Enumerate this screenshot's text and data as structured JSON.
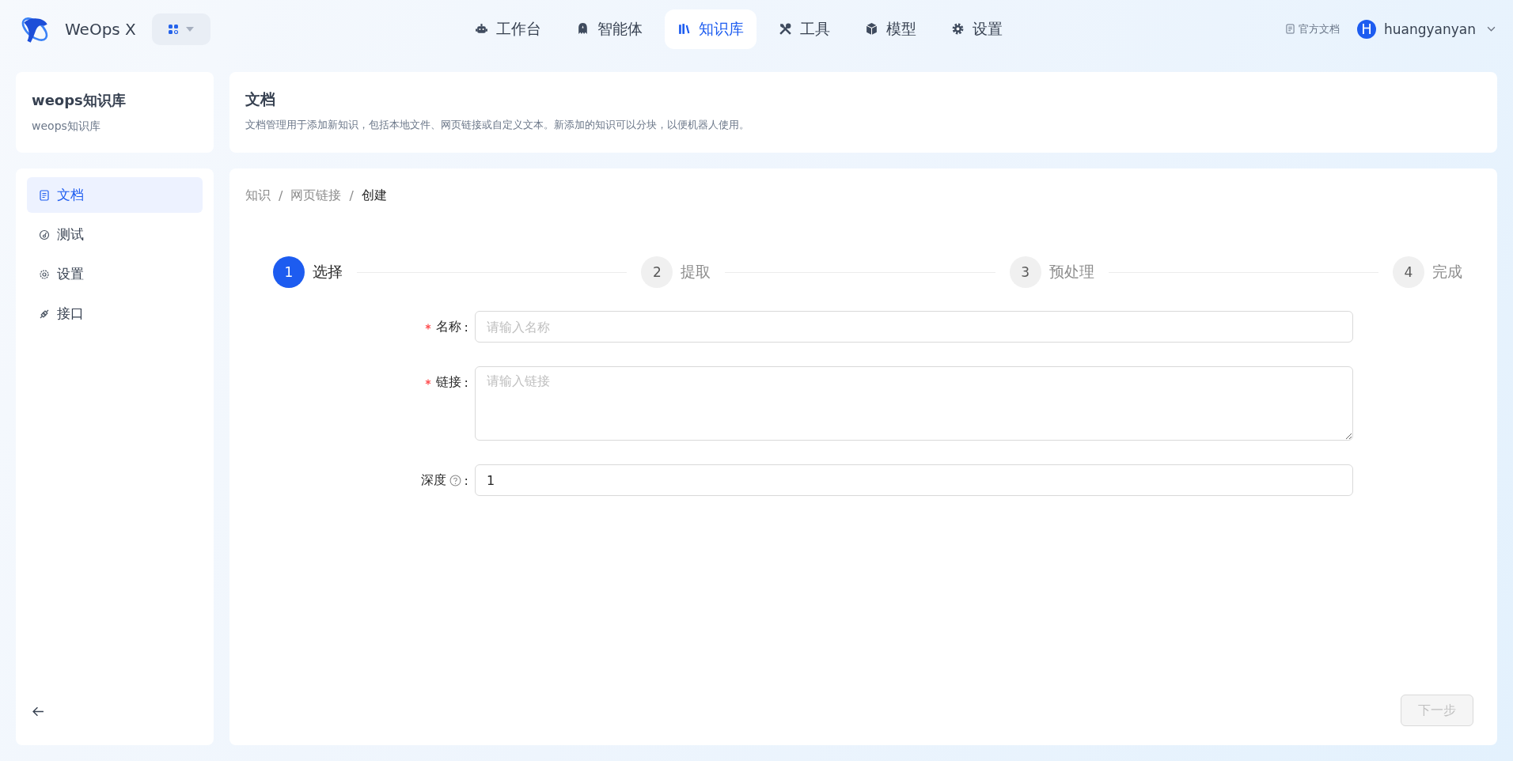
{
  "app": {
    "name": "WeOps X"
  },
  "nav": [
    {
      "label": "工作台",
      "selected": false
    },
    {
      "label": "智能体",
      "selected": false
    },
    {
      "label": "知识库",
      "selected": true
    },
    {
      "label": "工具",
      "selected": false
    },
    {
      "label": "模型",
      "selected": false
    },
    {
      "label": "设置",
      "selected": false
    }
  ],
  "docs_link": "官方文档",
  "user": {
    "initial": "H",
    "name": "huangyanyan"
  },
  "knowledge_base": {
    "title": "weops知识库",
    "subtitle": "weops知识库"
  },
  "sidebar": {
    "items": [
      {
        "label": "文档",
        "selected": true
      },
      {
        "label": "测试",
        "selected": false
      },
      {
        "label": "设置",
        "selected": false
      },
      {
        "label": "接口",
        "selected": false
      }
    ]
  },
  "header": {
    "title": "文档",
    "description": "文档管理用于添加新知识，包括本地文件、网页链接或自定义文本。新添加的知识可以分块，以便机器人使用。"
  },
  "breadcrumb": [
    {
      "label": "知识",
      "current": false
    },
    {
      "separator": "/",
      "label": "网页链接",
      "current": false
    },
    {
      "separator": "/",
      "label": "创建",
      "current": true
    }
  ],
  "steps": [
    {
      "number": "1",
      "label": "选择",
      "selected": true
    },
    {
      "number": "2",
      "label": "提取",
      "selected": false
    },
    {
      "number": "3",
      "label": "预处理",
      "selected": false
    },
    {
      "number": "4",
      "label": "完成",
      "selected": false
    }
  ],
  "form": [
    {
      "kind": "input",
      "label": "名称",
      "colon": ":",
      "required": true,
      "help": false,
      "placeholder": "请输入名称"
    },
    {
      "kind": "textarea",
      "label": "链接",
      "colon": ":",
      "required": true,
      "help": false,
      "placeholder": "请输入链接"
    },
    {
      "kind": "input",
      "label": "深度",
      "colon": ":",
      "required": false,
      "help": true,
      "value": "1"
    }
  ],
  "next_button": {
    "label": "下一步",
    "disabled": true
  }
}
